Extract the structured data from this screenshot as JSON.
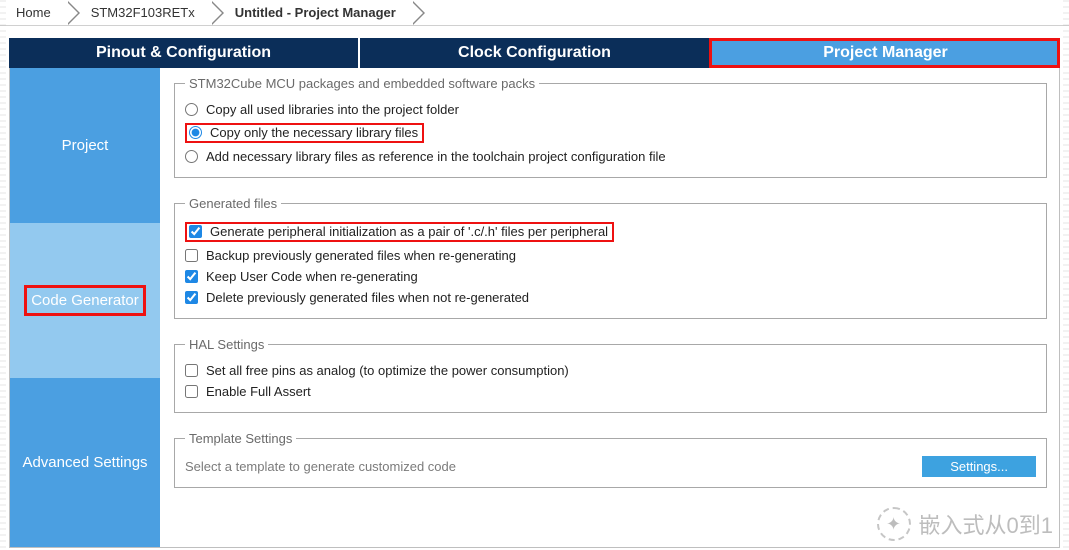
{
  "breadcrumbs": {
    "home": "Home",
    "chip": "STM32F103RETx",
    "project": "Untitled - Project Manager"
  },
  "tabs": {
    "pinout": "Pinout & Configuration",
    "clock": "Clock Configuration",
    "pm": "Project Manager"
  },
  "sidebar": {
    "project": "Project",
    "codegen": "Code Generator",
    "advanced": "Advanced Settings"
  },
  "packages": {
    "legend": "STM32Cube MCU packages and embedded software packs",
    "r1": "Copy all used libraries into the project folder",
    "r2": "Copy only the necessary library files",
    "r3": "Add necessary library files as reference in the toolchain project configuration file"
  },
  "generated": {
    "legend": "Generated files",
    "c1": "Generate peripheral initialization as a pair of '.c/.h' files per peripheral",
    "c2": "Backup previously generated files when re-generating",
    "c3": "Keep User Code when re-generating",
    "c4": "Delete previously generated files when not re-generated"
  },
  "hal": {
    "legend": "HAL Settings",
    "c1": "Set all free pins as analog (to optimize the power consumption)",
    "c2": "Enable Full Assert"
  },
  "template": {
    "legend": "Template Settings",
    "text": "Select a template to generate customized code",
    "btn": "Settings..."
  },
  "watermark": "嵌入式从0到1"
}
